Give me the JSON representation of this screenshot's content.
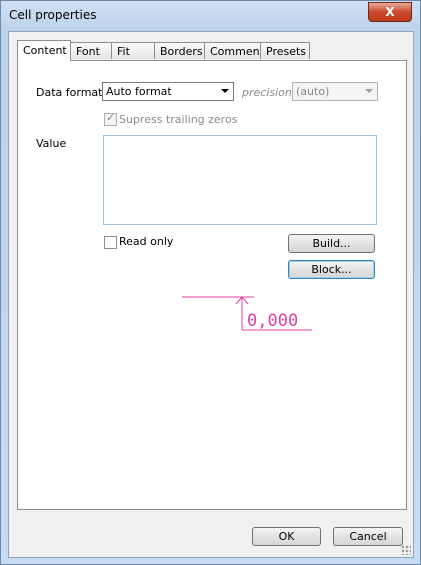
{
  "window": {
    "title": "Cell properties",
    "close_label": "X"
  },
  "tabs": [
    {
      "label": "Content",
      "active": true
    },
    {
      "label": "Font",
      "active": false
    },
    {
      "label": "Fit",
      "active": false
    },
    {
      "label": "Borders",
      "active": false
    },
    {
      "label": "Comment",
      "active": false
    },
    {
      "label": "Presets",
      "active": false
    }
  ],
  "content": {
    "data_format_label": "Data format",
    "data_format_value": "Auto format",
    "precision_label": "precision",
    "precision_value": "(auto)",
    "suppress_label": "Supress trailing zeros",
    "suppress_checked": true,
    "value_label": "Value",
    "value_text": "",
    "read_only_label": "Read only",
    "read_only_checked": false,
    "build_label": "Build...",
    "block_label": "Block...",
    "preview_text": "0,000",
    "preview_color": "#e040a0"
  },
  "footer": {
    "ok_label": "OK",
    "cancel_label": "Cancel"
  }
}
